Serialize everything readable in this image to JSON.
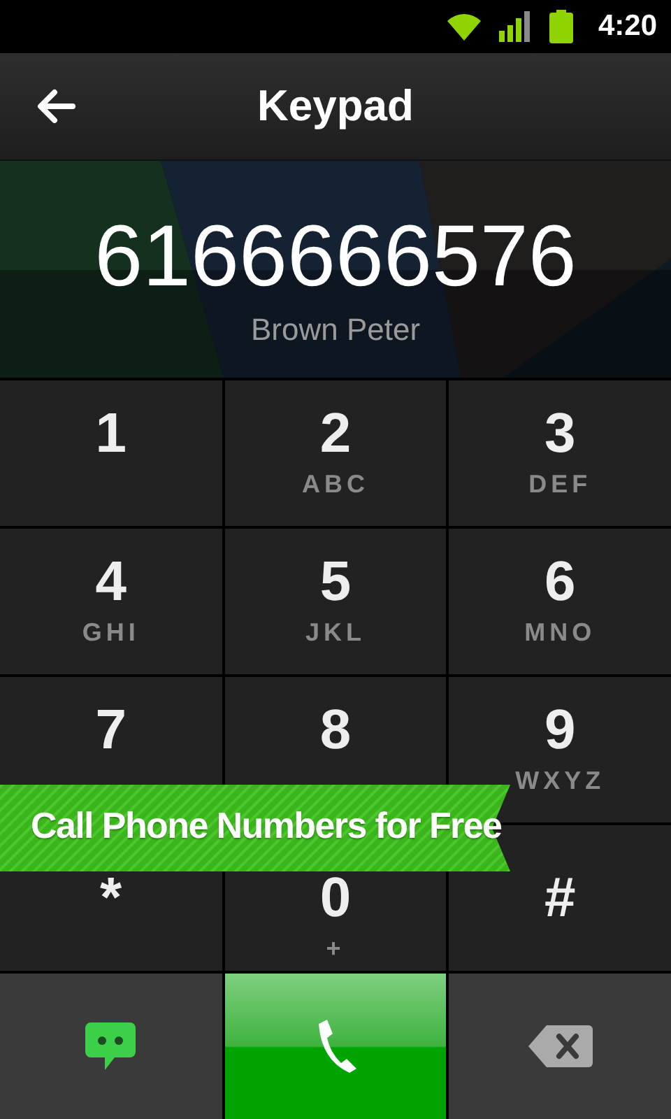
{
  "status_bar": {
    "time": "4:20"
  },
  "header": {
    "title": "Keypad"
  },
  "display": {
    "number": "6166666576",
    "contact": "Brown Peter"
  },
  "keys": [
    {
      "digit": "1"
    },
    {
      "digit": "2",
      "letters": "ABC"
    },
    {
      "digit": "3",
      "letters": "DEF"
    },
    {
      "digit": "4",
      "letters": "GHI"
    },
    {
      "digit": "5",
      "letters": "JKL"
    },
    {
      "digit": "6",
      "letters": "MNO"
    },
    {
      "digit": "7"
    },
    {
      "digit": "8"
    },
    {
      "digit": "9",
      "letters": "WXYZ"
    },
    {
      "digit": "*"
    },
    {
      "digit": "0",
      "letters": "+"
    },
    {
      "digit": "#"
    }
  ],
  "banner": {
    "text": "Call Phone Numbers for Free"
  }
}
